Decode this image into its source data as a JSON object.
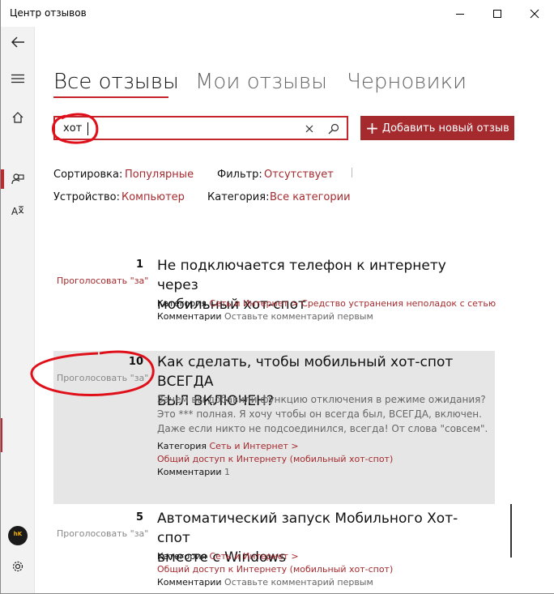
{
  "window": {
    "title": "Центр отзывов"
  },
  "tabs": [
    {
      "label": "Все отзывы"
    },
    {
      "label": "Мои отзывы"
    },
    {
      "label": "Черновики"
    }
  ],
  "search": {
    "value": "хот"
  },
  "add_button": {
    "label": "Добавить новый отзыв"
  },
  "filters": {
    "sort_label": "Сортировка:",
    "sort_value": "Популярные",
    "filter_label": "Фильтр:",
    "filter_value": "Отсутствует",
    "device_label": "Устройство:",
    "device_value": "Компьютер",
    "category_label": "Категория:",
    "category_value": "Все категории"
  },
  "items": [
    {
      "votes": "1",
      "vote_label": "Проголосовать \"за\"",
      "title_lines": [
        "Не подключается телефон к интернету через",
        "мобильный хот-спот"
      ],
      "body_lines": [],
      "category_label": "Категория",
      "category_main": "Сеть и Интернет",
      "category_sep": ">",
      "category_sub": "Средство устранения неполадок с сетью",
      "comments_label": "Комментарии",
      "comments_value": "Оставьте комментарий первым"
    },
    {
      "votes": "10",
      "vote_label": "Проголосовать \"за\"",
      "title_lines": [
        "Как сделать, чтобы мобильный хот-спот ВСЕГДА",
        "БЫЛ ВКЛЮЧЕН?"
      ],
      "body_lines": [
        "Зачем вы добавили функцию отключения в режиме ожидания?",
        "Это *** полная. Я хочу чтобы он всегда был, ВСЕГДА, включен.",
        "Даже если никто не подсоединился, всегда! От слова \"совсем\"."
      ],
      "category_label": "Категория",
      "category_main": "Сеть и Интернет",
      "category_sep": ">",
      "category_sub": "Общий доступ к Интернету (мобильный хот-спот)",
      "comments_label": "Комментарии",
      "comments_value": "1"
    },
    {
      "votes": "5",
      "vote_label": "Проголосовать \"за\"",
      "title_lines": [
        "Автоматический запуск Мобильного Хот-спот",
        "вместе с Windows"
      ],
      "body_lines": [],
      "category_label": "Категория",
      "category_main": "Сеть и Интернет",
      "category_sep": ">",
      "category_sub": "Общий доступ к Интернету (мобильный хот-спот)",
      "comments_label": "Комментарии",
      "comments_value": "Оставьте комментарий первым"
    }
  ],
  "colors": {
    "accent": "#c4262e",
    "link": "#a52a2e",
    "button": "#a52a2e",
    "highlight": "#e6e6e6",
    "annotation": "#e0101b"
  },
  "icons": {
    "back": "arrow-left-icon",
    "menu": "hamburger-icon",
    "home": "home-icon",
    "feedback": "feedback-icon",
    "language": "translate-icon",
    "settings": "gear-icon"
  }
}
